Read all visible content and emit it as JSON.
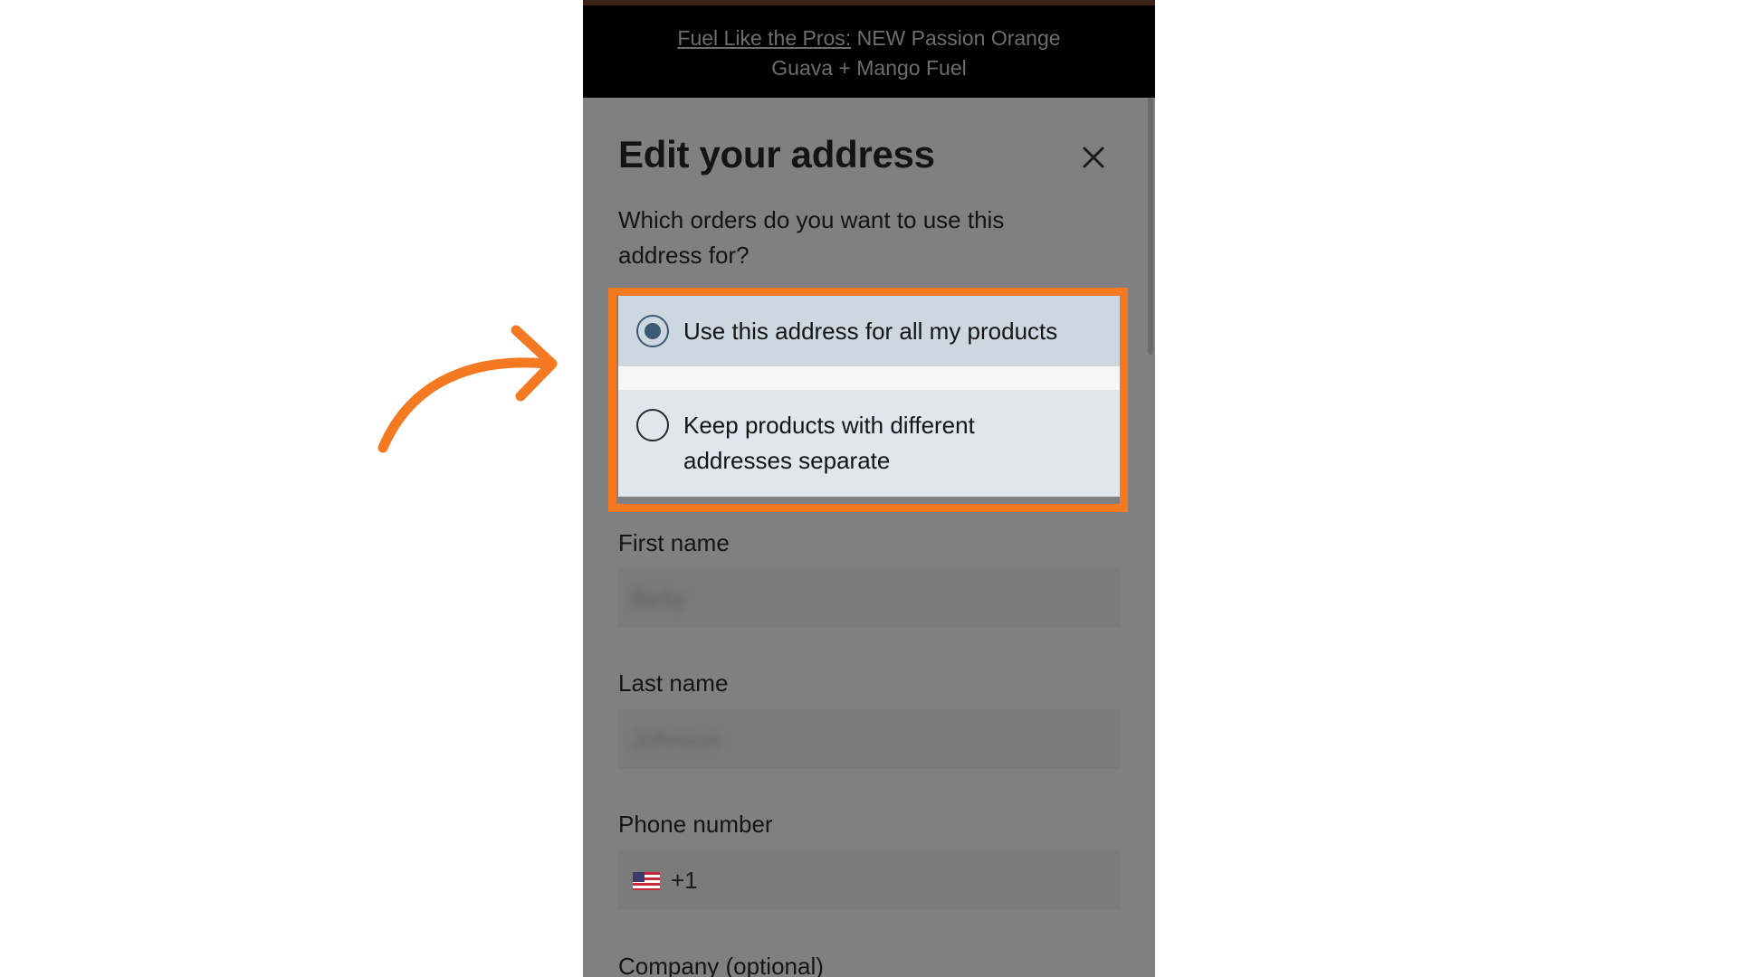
{
  "promo": {
    "link_text": "Fuel Like the Pros:",
    "text_line1": "NEW Passion Orange",
    "text_line2": "Guava + Mango Fuel"
  },
  "modal": {
    "title": "Edit your address",
    "question": "Which orders do you want to use this address for?",
    "options": [
      {
        "label": "Use this address for all my products",
        "selected": true
      },
      {
        "label": "Keep products with different addresses separate",
        "selected": false
      }
    ],
    "fields": {
      "first_name_label": "First name",
      "first_name_value": "Betty",
      "last_name_label": "Last name",
      "last_name_value": "Johnson",
      "phone_label": "Phone number",
      "phone_prefix": "+1",
      "company_label": "Company (optional)"
    }
  },
  "colors": {
    "highlight": "#f47920",
    "arrow": "#f47920",
    "selected_option_bg": "#ccd7df",
    "radio_selected": "#3c5a73"
  },
  "icons": {
    "close": "close-icon",
    "flag": "us-flag-icon",
    "arrow": "curved-arrow-icon"
  }
}
